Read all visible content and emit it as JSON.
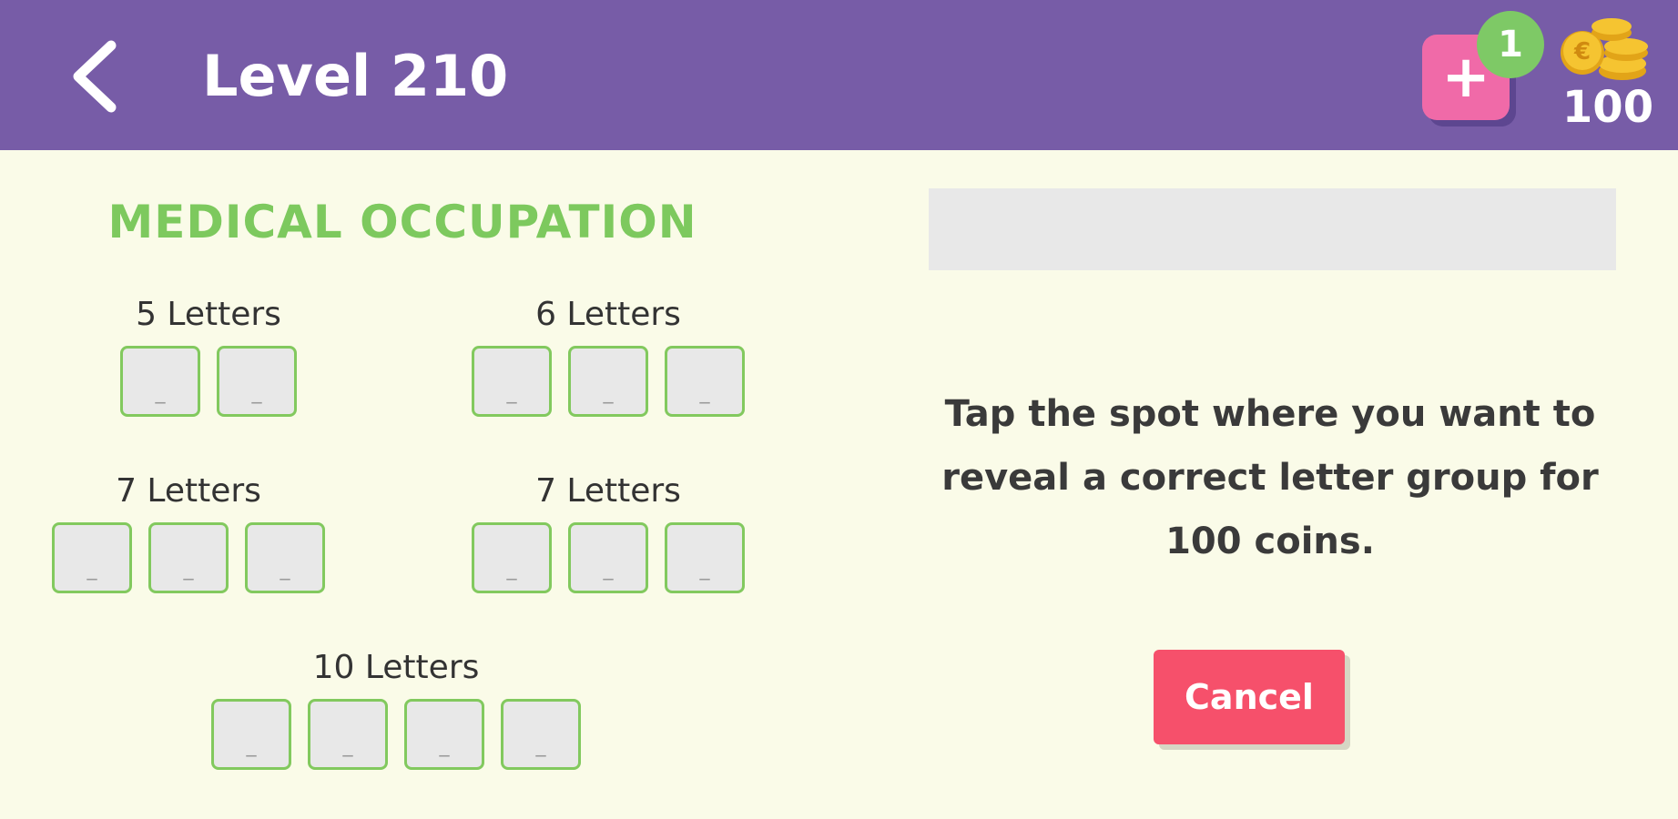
{
  "header": {
    "title": "Level 210",
    "back_icon": "chevron-left-icon",
    "add_icon": "plus-icon",
    "badge_count": "1",
    "coins_icon": "coin-stack-icon",
    "coins": "100",
    "background_color": "#775ca7"
  },
  "puzzle": {
    "category": "MEDICAL OCCUPATION",
    "groups": [
      {
        "label": "5 Letters",
        "slots": [
          "_",
          "_"
        ]
      },
      {
        "label": "6 Letters",
        "slots": [
          "_",
          "_",
          "_"
        ]
      },
      {
        "label": "7 Letters",
        "slots": [
          "_",
          "_",
          "_"
        ]
      },
      {
        "label": "7 Letters",
        "slots": [
          "_",
          "_",
          "_"
        ]
      },
      {
        "label": "10 Letters",
        "slots": [
          "_",
          "_",
          "_",
          "_"
        ]
      }
    ]
  },
  "hint": {
    "message": "Tap the spot where you want to reveal a correct letter group for 100 coins.",
    "cancel_label": "Cancel"
  },
  "colors": {
    "accent_green": "#7dc95e",
    "cancel_red": "#f6506b",
    "add_pink": "#f06aa8",
    "background": "#fafbe8"
  }
}
